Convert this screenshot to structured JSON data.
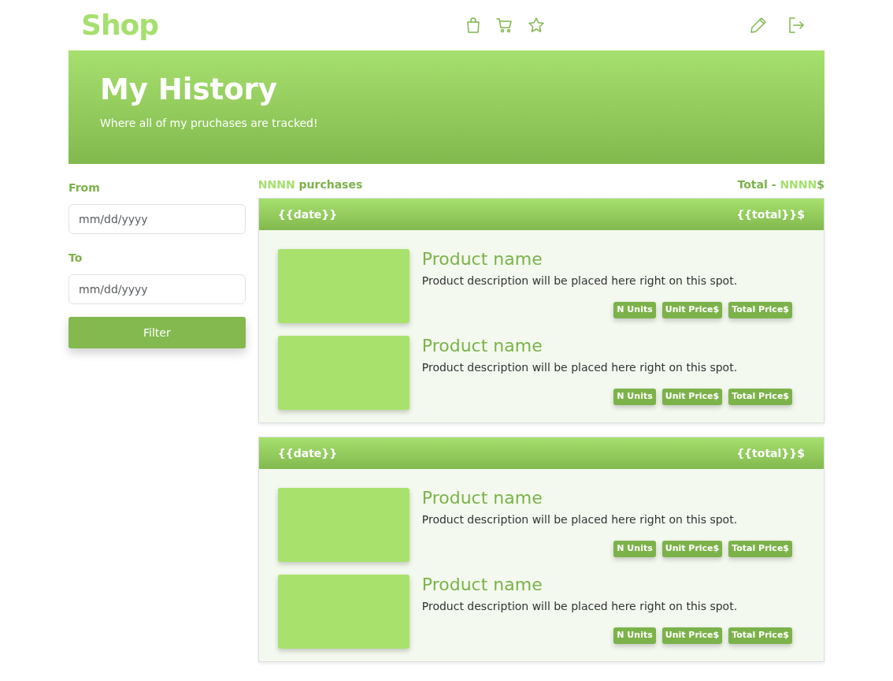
{
  "brand": "Shop",
  "hero": {
    "title": "My History",
    "subtitle": "Where all of my pruchases are tracked!"
  },
  "filters": [
    {
      "label": "From",
      "placeholder": "mm/dd/yyyy"
    },
    {
      "label": "To",
      "placeholder": "mm/dd/yyyy"
    }
  ],
  "filter_button": "Filter",
  "summary": {
    "count": "NNNN",
    "count_label": "purchases",
    "total_label": "Total -",
    "total_value": "NNNN",
    "total_currency": "$"
  },
  "orders": [
    {
      "date": "{{date}}",
      "total": "{{total}}$",
      "products": [
        {
          "name": "Product name",
          "description": "Product description will be placed here right on this spot.",
          "tags": [
            "N Units",
            "Unit Price$",
            "Total Price$"
          ]
        },
        {
          "name": "Product name",
          "description": "Product description will be placed here right on this spot.",
          "tags": [
            "N Units",
            "Unit Price$",
            "Total Price$"
          ]
        }
      ]
    },
    {
      "date": "{{date}}",
      "total": "{{total}}$",
      "products": [
        {
          "name": "Product name",
          "description": "Product description will be placed here right on this spot.",
          "tags": [
            "N Units",
            "Unit Price$",
            "Total Price$"
          ]
        },
        {
          "name": "Product name",
          "description": "Product description will be placed here right on this spot.",
          "tags": [
            "N Units",
            "Unit Price$",
            "Total Price$"
          ]
        }
      ]
    }
  ]
}
